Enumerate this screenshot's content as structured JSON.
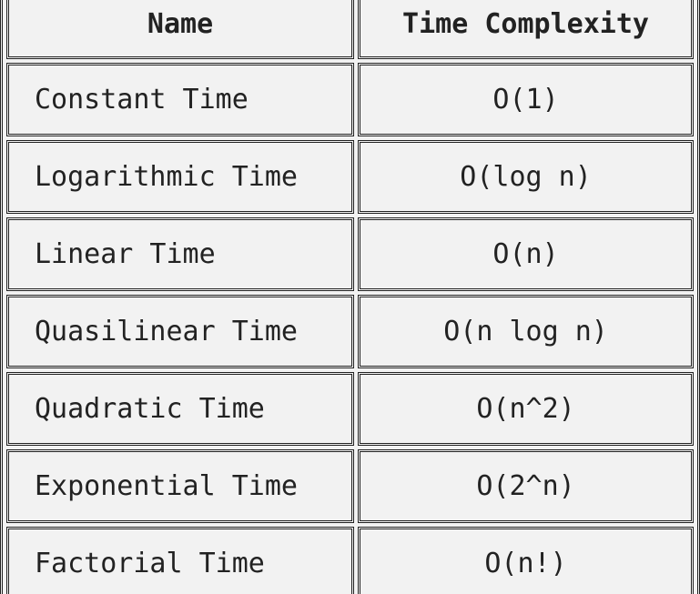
{
  "headers": {
    "name": "Name",
    "complexity": "Time Complexity"
  },
  "rows": [
    {
      "name": "Constant Time",
      "complexity": "O(1)"
    },
    {
      "name": "Logarithmic Time",
      "complexity": "O(log n)"
    },
    {
      "name": "Linear Time",
      "complexity": "O(n)"
    },
    {
      "name": "Quasilinear Time",
      "complexity": "O(n log n)"
    },
    {
      "name": "Quadratic Time",
      "complexity": "O(n^2)"
    },
    {
      "name": "Exponential Time",
      "complexity": "O(2^n)"
    },
    {
      "name": "Factorial Time",
      "complexity": "O(n!)"
    }
  ]
}
